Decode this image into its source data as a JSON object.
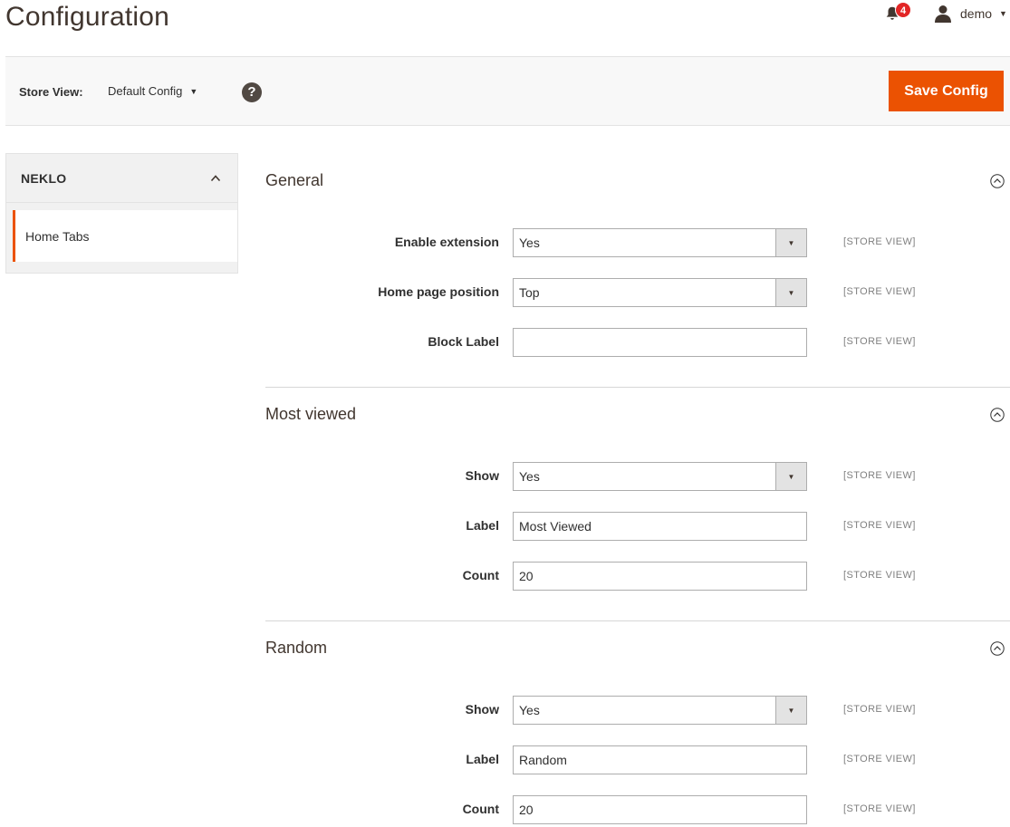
{
  "header": {
    "title": "Configuration",
    "notifications_count": "4",
    "user_name": "demo"
  },
  "toolbar": {
    "store_view_label": "Store View:",
    "store_view_value": "Default Config",
    "help_icon": "question-circle-icon",
    "save_label": "Save Config"
  },
  "sidebar": {
    "group_title": "NEKLO",
    "items": [
      {
        "label": "Home Tabs",
        "active": true
      }
    ]
  },
  "sections": [
    {
      "title": "General",
      "fields": [
        {
          "label": "Enable extension",
          "type": "select",
          "value": "Yes",
          "scope": "[STORE VIEW]"
        },
        {
          "label": "Home page position",
          "type": "select",
          "value": "Top",
          "scope": "[STORE VIEW]"
        },
        {
          "label": "Block Label",
          "type": "text",
          "value": "",
          "scope": "[STORE VIEW]"
        }
      ]
    },
    {
      "title": "Most viewed",
      "fields": [
        {
          "label": "Show",
          "type": "select",
          "value": "Yes",
          "scope": "[STORE VIEW]"
        },
        {
          "label": "Label",
          "type": "text",
          "value": "Most Viewed",
          "scope": "[STORE VIEW]"
        },
        {
          "label": "Count",
          "type": "text",
          "value": "20",
          "scope": "[STORE VIEW]"
        }
      ]
    },
    {
      "title": "Random",
      "fields": [
        {
          "label": "Show",
          "type": "select",
          "value": "Yes",
          "scope": "[STORE VIEW]"
        },
        {
          "label": "Label",
          "type": "text",
          "value": "Random",
          "scope": "[STORE VIEW]"
        },
        {
          "label": "Count",
          "type": "text",
          "value": "20",
          "scope": "[STORE VIEW]"
        }
      ]
    }
  ],
  "colors": {
    "accent": "#eb5202",
    "title": "#41362f",
    "toolbar_bg": "#f8f8f8"
  }
}
